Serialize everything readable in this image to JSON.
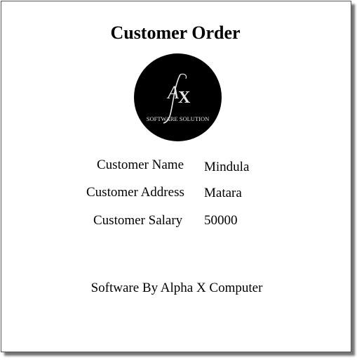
{
  "report": {
    "title": "Customer Order",
    "logo": {
      "monogram": "AX",
      "tagline": "SOFTWARE SOLUTION"
    },
    "fields": {
      "name_label": "Customer Name",
      "name_value": "Mindula",
      "address_label": "Customer Address",
      "address_value": "Matara",
      "salary_label": "Customer Salary",
      "salary_value": "50000"
    },
    "footer": "Software By Alpha X Computer"
  },
  "colors": {
    "background": "#ffffff",
    "text": "#000000",
    "logo_background": "#000000",
    "logo_foreground": "#e6e6e6"
  }
}
